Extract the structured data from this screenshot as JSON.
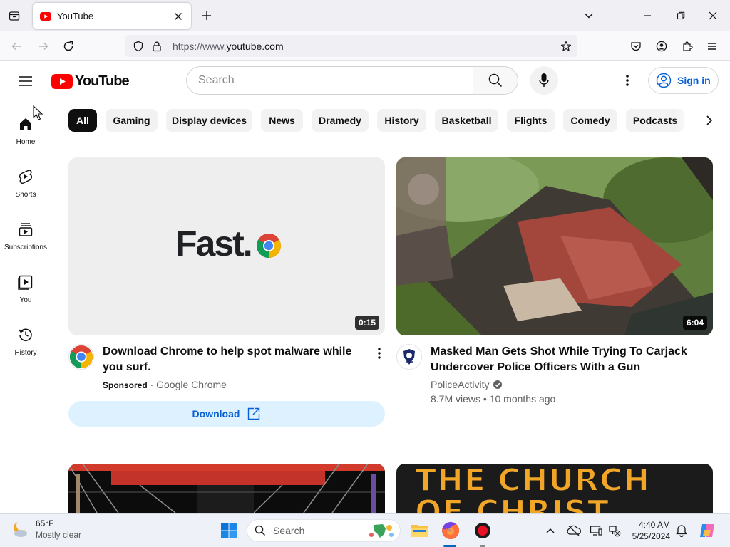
{
  "browser": {
    "tab_title": "YouTube",
    "url_prefix": "https://www.",
    "url_domain": "youtube.com"
  },
  "youtube": {
    "logo_text": "YouTube",
    "search_placeholder": "Search",
    "sign_in": "Sign in",
    "guide": [
      {
        "label": "Home",
        "icon": "home-icon"
      },
      {
        "label": "Shorts",
        "icon": "shorts-icon"
      },
      {
        "label": "Subscriptions",
        "icon": "subscriptions-icon"
      },
      {
        "label": "You",
        "icon": "you-icon"
      },
      {
        "label": "History",
        "icon": "history-icon"
      }
    ],
    "chips": [
      "All",
      "Gaming",
      "Display devices",
      "News",
      "Dramedy",
      "History",
      "Basketball",
      "Flights",
      "Comedy",
      "Podcasts"
    ],
    "videos": [
      {
        "thumb_text": "Fast.",
        "duration": "0:15",
        "title": "Download Chrome to help spot malware while you surf.",
        "sponsored": "Sponsored",
        "separator": "·",
        "channel": "Google Chrome",
        "cta": "Download"
      },
      {
        "duration": "6:04",
        "title": "Masked Man Gets Shot While Trying To Carjack Undercover Police Officers With a Gun",
        "channel": "PoliceActivity",
        "views": "8.7M views",
        "separator": "•",
        "age": "10 months ago"
      },
      {
        "thumb_text": "THE CHURCH OF CHRIST"
      }
    ]
  },
  "taskbar": {
    "temp": "65°F",
    "weather": "Mostly clear",
    "search": "Search",
    "time": "4:40 AM",
    "date": "5/25/2024"
  },
  "colors": {
    "yt_red": "#ff0000",
    "link_blue": "#065fd4",
    "chip_active": "#0f0f0f",
    "chip_bg": "#f2f2f2"
  }
}
